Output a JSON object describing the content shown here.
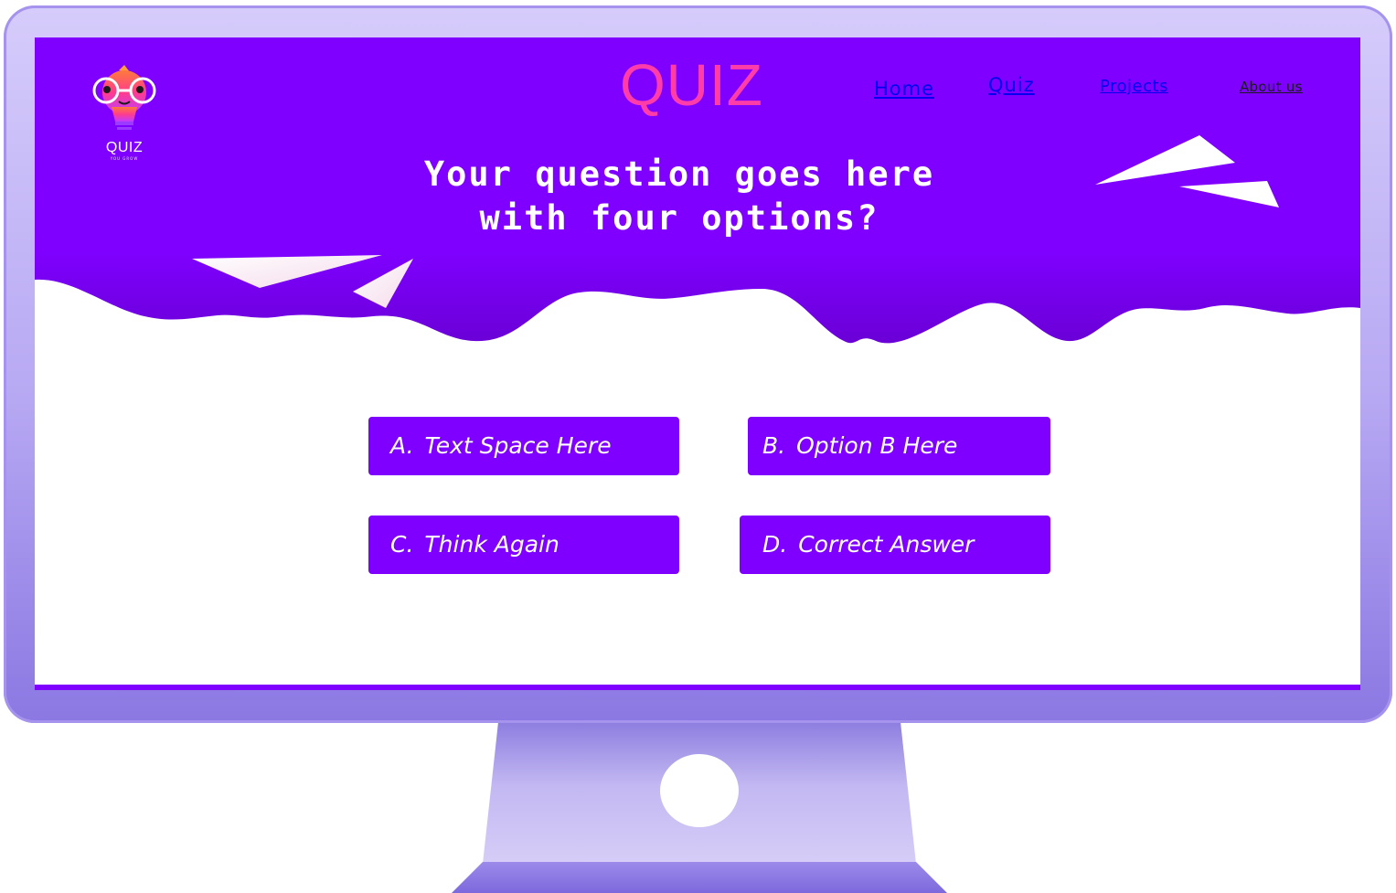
{
  "logo": {
    "text": "QUIZ",
    "tagline": "YOU GROW"
  },
  "header": {
    "title": "QUIZ",
    "nav": [
      {
        "label": "Home"
      },
      {
        "label": "Quiz"
      },
      {
        "label": "Projects"
      },
      {
        "label": "About us"
      }
    ]
  },
  "question": {
    "line1": "Your question goes here",
    "line2": "with four options?"
  },
  "options": [
    {
      "letter": "A.",
      "text": "Text Space Here"
    },
    {
      "letter": "B.",
      "text": "Option B Here"
    },
    {
      "letter": "C.",
      "text": "Think Again"
    },
    {
      "letter": "D.",
      "text": "Correct Answer"
    }
  ],
  "colors": {
    "primary_purple": "#7f00ff",
    "title_pink": "#ff3ca8",
    "monitor_frame": "#b7a8f3",
    "stand": "#c9bff5"
  },
  "icons": [
    "lightbulb-mascot-icon",
    "paper-plane-icon",
    "camera-icon"
  ]
}
